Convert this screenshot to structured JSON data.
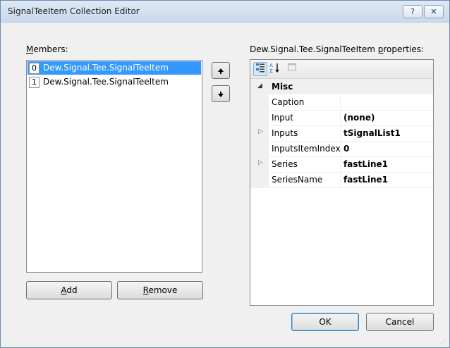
{
  "window": {
    "title": "SignalTeeItem Collection Editor",
    "help_label": "?",
    "close_label": "✕"
  },
  "members": {
    "label_underlined": "M",
    "label_rest": "embers:",
    "items": [
      {
        "index": "0",
        "text": "Dew.Signal.Tee.SignalTeeItem",
        "selected": true
      },
      {
        "index": "1",
        "text": "Dew.Signal.Tee.SignalTeeItem",
        "selected": false
      }
    ],
    "up_icon": "arrow-up-icon",
    "down_icon": "arrow-down-icon"
  },
  "buttons": {
    "add_underlined": "A",
    "add_rest": "dd",
    "remove_underlined": "R",
    "remove_rest": "emove",
    "ok": "OK",
    "cancel": "Cancel"
  },
  "properties": {
    "label_prefix": "Dew.Signal.Tee.SignalTeeItem ",
    "label_underlined": "p",
    "label_rest": "roperties:",
    "toolbar": [
      "categorized-icon",
      "alphabetical-icon",
      "property-pages-icon"
    ],
    "category": "Misc",
    "rows": [
      {
        "name": "Caption",
        "value": "",
        "expandable": false
      },
      {
        "name": "Input",
        "value": "(none)",
        "expandable": false
      },
      {
        "name": "Inputs",
        "value": "tSignalList1",
        "expandable": true
      },
      {
        "name": "InputsItemIndex",
        "value": "0",
        "expandable": false
      },
      {
        "name": "Series",
        "value": "fastLine1",
        "expandable": true
      },
      {
        "name": "SeriesName",
        "value": "fastLine1",
        "expandable": false
      }
    ]
  },
  "colors": {
    "selection": "#3399ff",
    "title_gradient_top": "#dfe9f5"
  }
}
